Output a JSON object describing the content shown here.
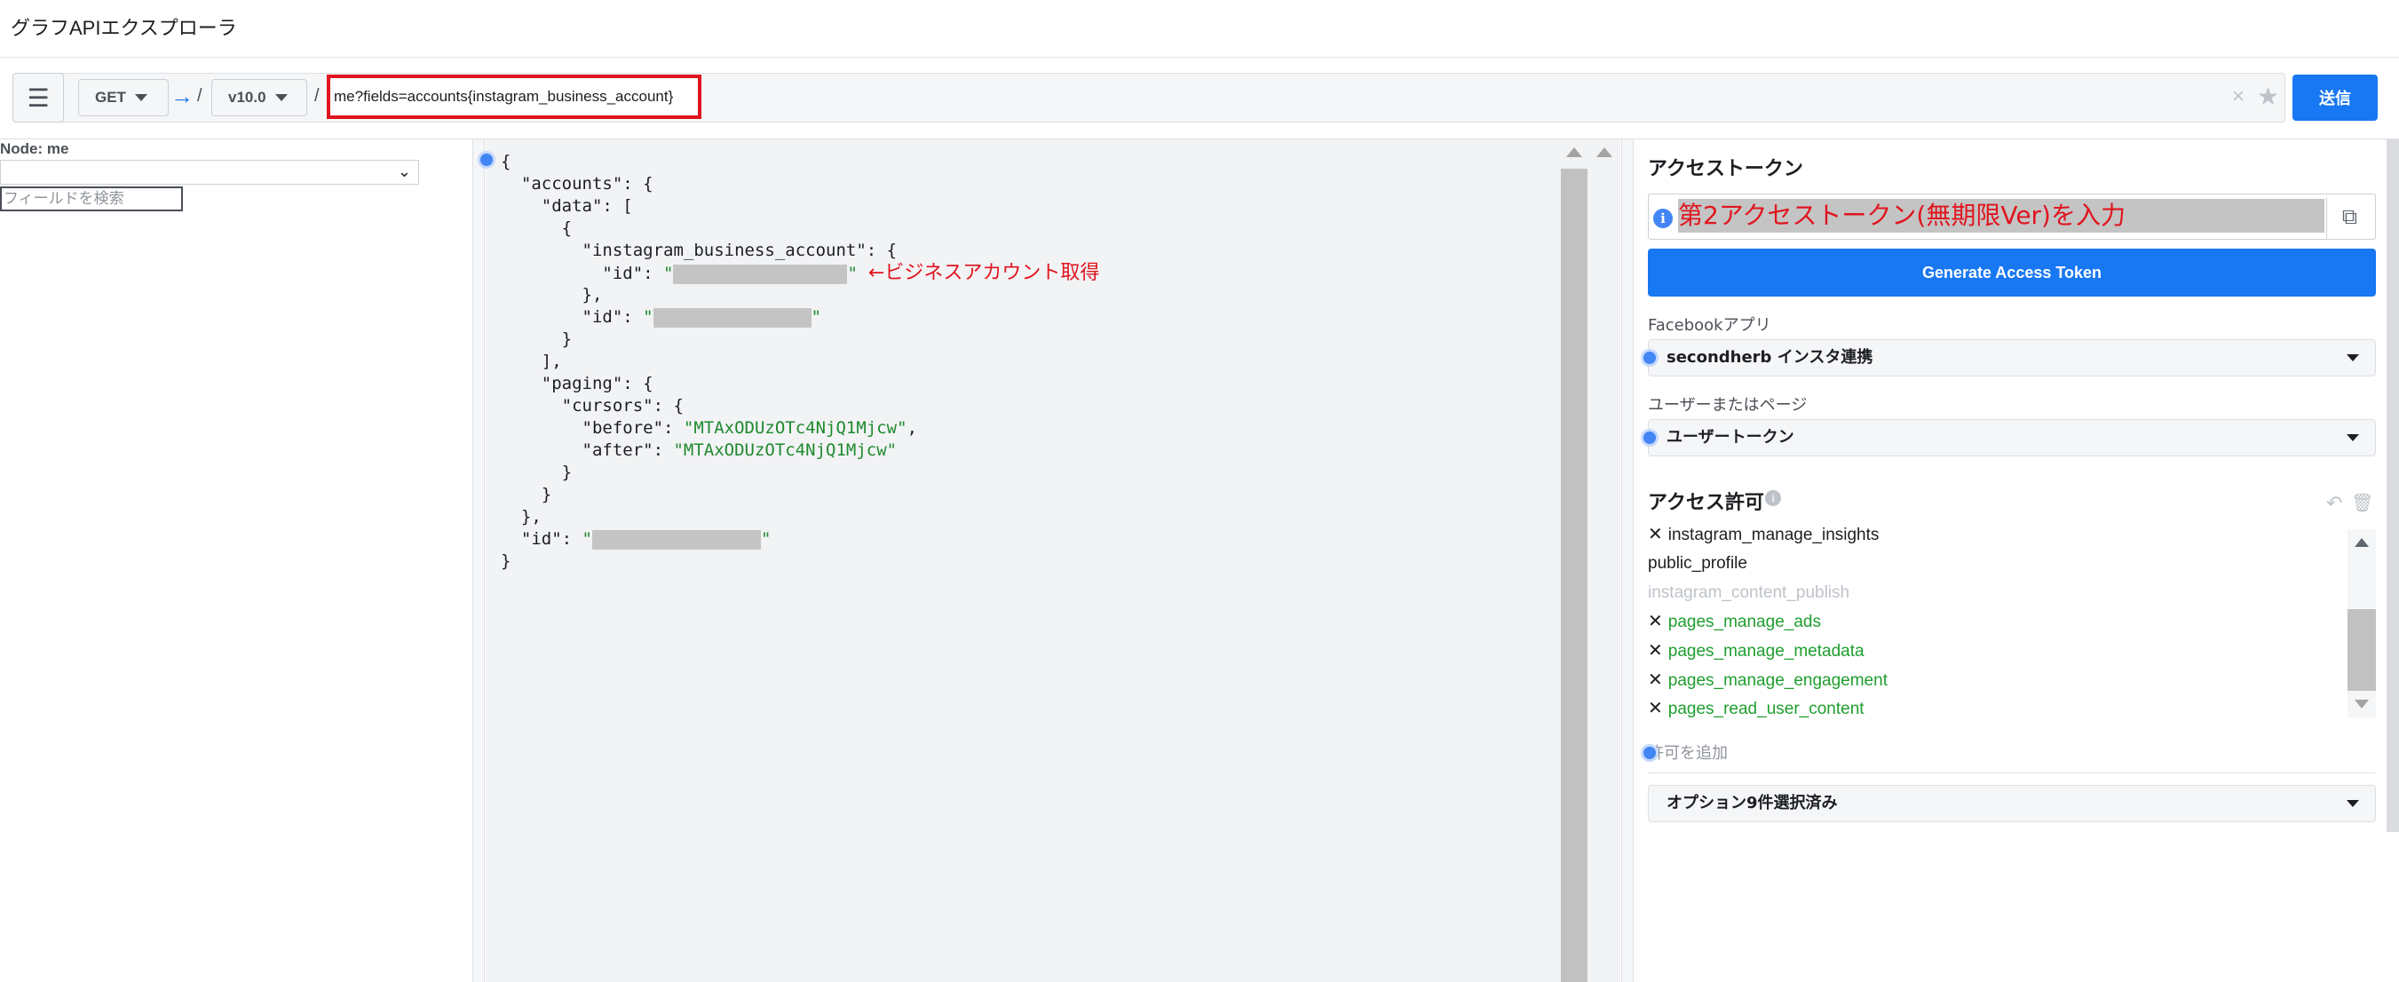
{
  "page": {
    "title": "グラフAPIエクスプローラ"
  },
  "toolbar": {
    "method": "GET",
    "arrow": "→",
    "slash": "/",
    "version": "v10.0",
    "query_value": "me?fields=accounts{instagram_business_account}",
    "clear_glyph": "×",
    "star_glyph": "★",
    "submit_label": "送信"
  },
  "left_panel": {
    "node_label": "Node: me",
    "search_placeholder": "フィールドを検索"
  },
  "json": {
    "line01": "{",
    "line02": "  \"accounts\": {",
    "line03": "    \"data\": [",
    "line04": "      {",
    "line05": "        \"instagram_business_account\": {",
    "line06_key": "          \"id\": ",
    "q": "\"",
    "annotation": "←ビジネスアカウント取得",
    "line07": "        },",
    "line08_key": "        \"id\": ",
    "line09": "      }",
    "line10": "    ],",
    "line11": "    \"paging\": {",
    "line12": "      \"cursors\": {",
    "line13_key": "        \"before\": ",
    "line13_val": "\"MTAxODUzOTc4NjQ1Mjcw\"",
    "line13_end": ",",
    "line14_key": "        \"after\": ",
    "line14_val": "\"MTAxODUzOTc4NjQ1Mjcw\"",
    "line15": "      }",
    "line16": "    }",
    "line17": "  },",
    "line18_key": "  \"id\": ",
    "line19": "}"
  },
  "right_panel": {
    "token_title": "アクセストークン",
    "token_value": "第2アクセストークン(無期限Ver)を入力",
    "info_glyph": "i",
    "copy_glyph": "⧉",
    "generate_label": "Generate Access Token",
    "app_label": "Facebookアプリ",
    "app_value": "secondherb インスタ連携",
    "user_label": "ユーザーまたはページ",
    "user_value": "ユーザートークン",
    "perm_title": "アクセス許可",
    "perm_info_glyph": "i",
    "undo_glyph": "↶",
    "trash_glyph": "🗑",
    "x_glyph": "✕",
    "permissions": [
      {
        "label": "instagram_manage_insights",
        "color": "#1c1e21"
      },
      {
        "label": "public_profile",
        "color": "#1c1e21"
      },
      {
        "label": "instagram_content_publish",
        "color": "#bec3c9"
      },
      {
        "label": "pages_manage_ads",
        "color": "#1f9e2e"
      },
      {
        "label": "pages_manage_metadata",
        "color": "#1f9e2e"
      },
      {
        "label": "pages_manage_engagement",
        "color": "#1f9e2e"
      },
      {
        "label": "pages_read_user_content",
        "color": "#1f9e2e"
      }
    ],
    "add_permission": "許可を追加",
    "options_value": "オプション9件選択済み"
  },
  "colors": {
    "accent": "#1877f2",
    "highlight_red": "#e0141e",
    "json_string": "#1f8a2e"
  }
}
